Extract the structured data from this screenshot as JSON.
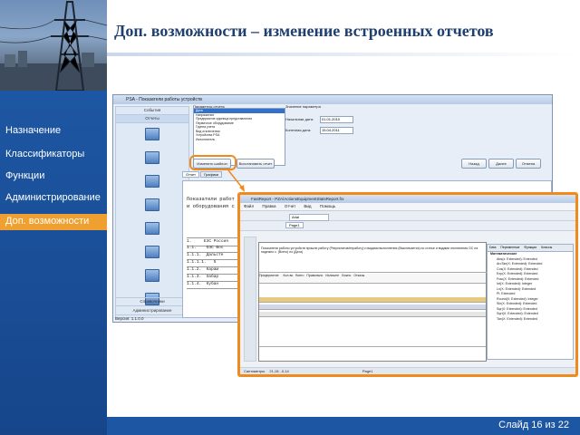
{
  "slide": {
    "title": "Доп. возможности – изменение встроенных отчетов",
    "footer": "Слайд 16 из 22"
  },
  "sidebar": {
    "items": [
      {
        "label": "Назначение"
      },
      {
        "label": "Классификаторы"
      },
      {
        "label": "Функции"
      },
      {
        "label": "Администрирование"
      },
      {
        "label": "Доп. возможности",
        "active": true
      }
    ]
  },
  "screenshot1": {
    "title": "PSA - Показатели работы устройств",
    "nav_tabs": [
      "События",
      "Отчеты"
    ],
    "nav_items": [
      "",
      "",
      "",
      "",
      "",
      "",
      "",
      ""
    ],
    "nav_bottom": [
      "Справочники",
      "Администрирование"
    ],
    "params_header": "Параметры отчета",
    "params": [
      "Дата",
      "Напряжение",
      "Предприятие-единица представления",
      "Первичное оборудование",
      "Группа учета",
      "Вид отключения",
      "Устройства PSA",
      "Исполнитель"
    ],
    "values_header": "Значение параметра",
    "start_label": "Начальная дата:",
    "start_value": "01.01.2010",
    "end_label": "Конечная дата:",
    "end_value": "15.04.2011",
    "btn_change": "Изменить шаблон",
    "btn_reset": "Восстановить отчет",
    "btn_back": "Назад",
    "btn_next": "Далее",
    "btn_cancel": "Отмена",
    "doc_tabs": [
      "Отчет",
      "Графики"
    ],
    "doc_line1": "Показатели работ",
    "doc_line2": "и оборудования с",
    "rows": [
      "1.",
      "1.1.",
      "1.1.1.",
      "1.1.1.1.",
      "1.1.2.",
      "1.1.3.",
      "1.1.4."
    ],
    "row_texts": [
      "ЕЭС Россия",
      "ОЭС Вос",
      "Дальсте",
      "5",
      "Карам",
      "Хабар",
      "Кубан"
    ],
    "version": "Версия: 1.1.0.0"
  },
  "screenshot2": {
    "title": "FastReport - PZA\\ActionsEquipmentStatsReport.frx",
    "menu": [
      "Файл",
      "Правка",
      "Отчет",
      "Вид",
      "Помощь"
    ],
    "font_name": "Arial",
    "page_tab": "Page1",
    "report_header": "Показатели работы устройств прошли работу (Результатов/неработу) и видами выполнения (Выключается) по статье и видами отключения ОС на надежно с. (Всего) по (Дата)",
    "columns": [
      "Предприятие",
      "Кол-во",
      "Всего",
      "Правильно",
      "Излишне",
      "Ложно",
      "Отказы"
    ],
    "tree_tabs": [
      "Data",
      "Переменные",
      "Функции",
      "Классы"
    ],
    "tree_head": "Математические",
    "tree_items": [
      "Abs(x: Extended): Extended",
      "ArcTan(X: Extended): Extended",
      "Cos(X: Extended): Extended",
      "Exp(X: Extended): Extended",
      "Frac(X: Extended): Extended",
      "Int(X: Extended): Integer",
      "Ln(X: Extended): Extended",
      "Pi: Extended",
      "Round(X: Extended): Integer",
      "Sin(X: Extended): Extended",
      "Sqr(X: Extended): Extended",
      "Sqrt(X: Extended): Extended",
      "Tan(X: Extended): Extended"
    ],
    "status_left": "Сантиметры",
    "status_mid": "21,15; -0,14",
    "status_right": "Page1"
  }
}
